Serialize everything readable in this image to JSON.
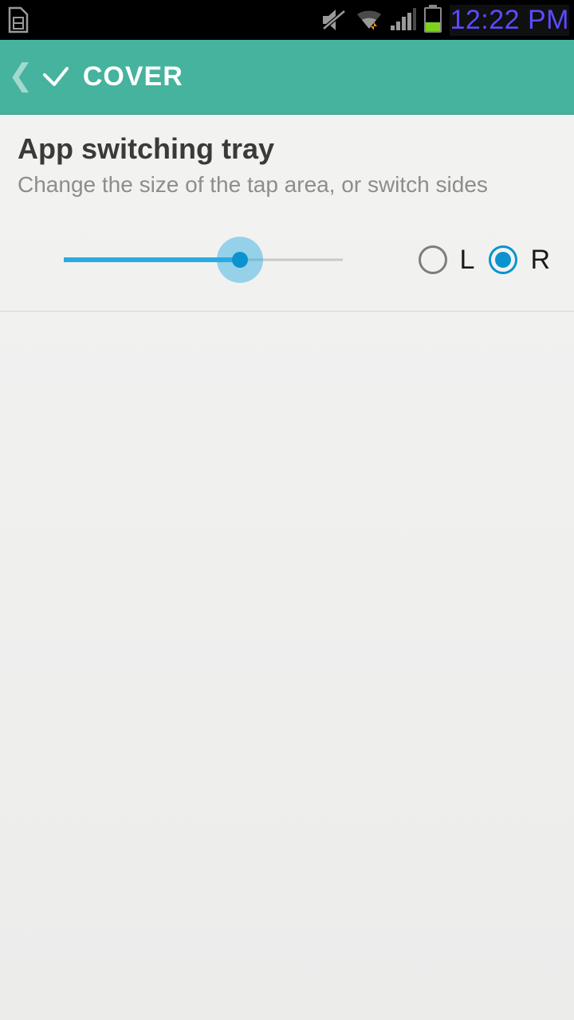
{
  "status": {
    "time": "12:22 PM"
  },
  "appbar": {
    "title": "COVER"
  },
  "section": {
    "title": "App switching tray",
    "subtitle": "Change the size of the tap area, or switch sides"
  },
  "slider": {
    "percent": 63
  },
  "side": {
    "left_label": "L",
    "right_label": "R",
    "selected": "R"
  }
}
